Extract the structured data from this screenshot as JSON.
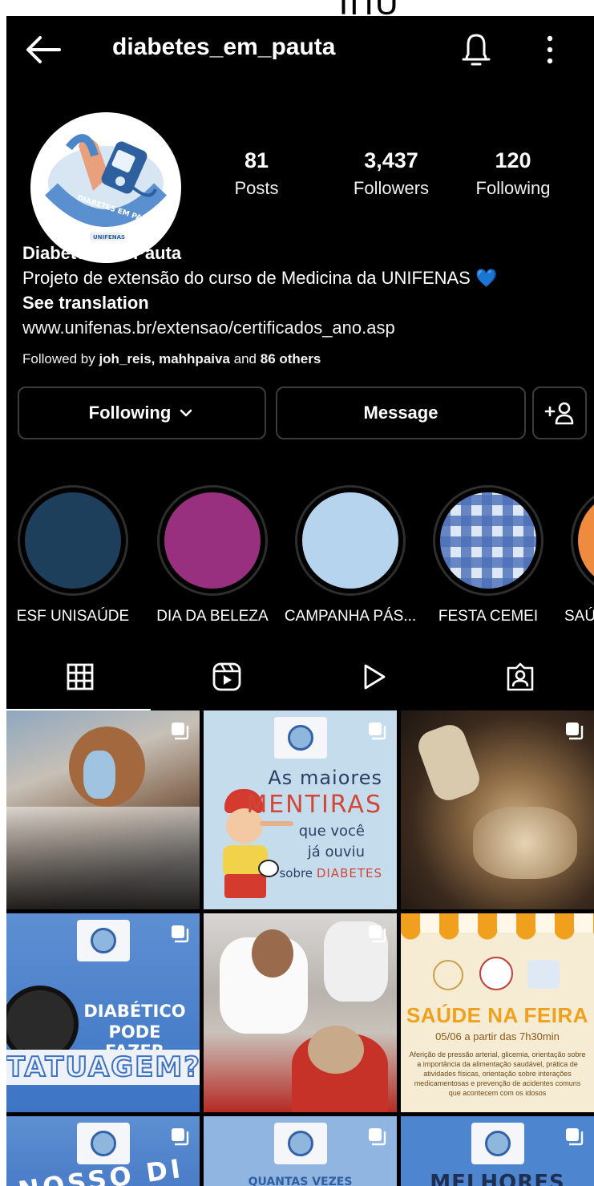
{
  "header": {
    "username": "diabetes_em_pauta"
  },
  "stats": {
    "posts": {
      "value": "81",
      "label": "Posts"
    },
    "followers": {
      "value": "3,437",
      "label": "Followers"
    },
    "following": {
      "value": "120",
      "label": "Following"
    }
  },
  "avatar": {
    "text": "DIABETES EM PAUTA",
    "org": "UNIFENAS"
  },
  "bio": {
    "name": "Diabetes Em Pauta",
    "description": "Projeto de extensão do curso de Medicina da UNIFENAS",
    "emoji": "💙",
    "see_translation": "See translation",
    "link": "www.unifenas.br/extensao/certificados_ano.asp"
  },
  "followed_by": {
    "prefix": "Followed by",
    "names": "joh_reis, mahhpaiva",
    "and": "and",
    "others": "86 others"
  },
  "actions": {
    "following": "Following",
    "chevron": "⌄",
    "message": "Message",
    "add_user_icon": "add-person-icon"
  },
  "highlights": [
    {
      "label": "ESF UNISAÚDE",
      "color": "#1d3f5c"
    },
    {
      "label": "DIA DA BELEZA",
      "color": "#98307f"
    },
    {
      "label": "CAMPANHA PÁS...",
      "color": "#b6d4ee"
    },
    {
      "label": "FESTA CEMEI",
      "color": "#6d8cc4"
    },
    {
      "label": "SAÚ",
      "color": "#ee8b3e"
    }
  ],
  "tabs": [
    {
      "name": "grid-icon",
      "active": true
    },
    {
      "name": "reels-icon",
      "active": false
    },
    {
      "name": "videos-icon",
      "active": false
    },
    {
      "name": "tagged-icon",
      "active": false
    }
  ],
  "posts": {
    "p2": {
      "line1": "As maiores",
      "line2": "MENTIRAS",
      "line3": "que você",
      "line4": "já ouviu",
      "line5a": "sobre",
      "line5b": "DIABETES"
    },
    "p4": {
      "line1": "DIABÉTICO",
      "line2": "PODE FAZER",
      "line3": "TATUAGEM?"
    },
    "p6": {
      "title": "SAÚDE NA FEIRA",
      "date": "05/06 a partir das 7h30min",
      "body": "Aferição de pressão arterial, glicemia, orientação sobre a importância da alimentação saudável, prática de atividades físicas, orientação sobre interações medicamentosas e prevenção de acidentes comuns que acontecem com os idosos"
    },
    "p7": {
      "text": "NOSSO DI"
    },
    "p8": {
      "text": "QUANTAS VEZES"
    },
    "p9": {
      "text": "MELHORES"
    }
  },
  "colors": {
    "background": "#000000",
    "text": "#ffffff",
    "button_border": "#3c3c3c",
    "mentiras_red": "#d0473a",
    "feira_orange": "#f0a01c"
  }
}
